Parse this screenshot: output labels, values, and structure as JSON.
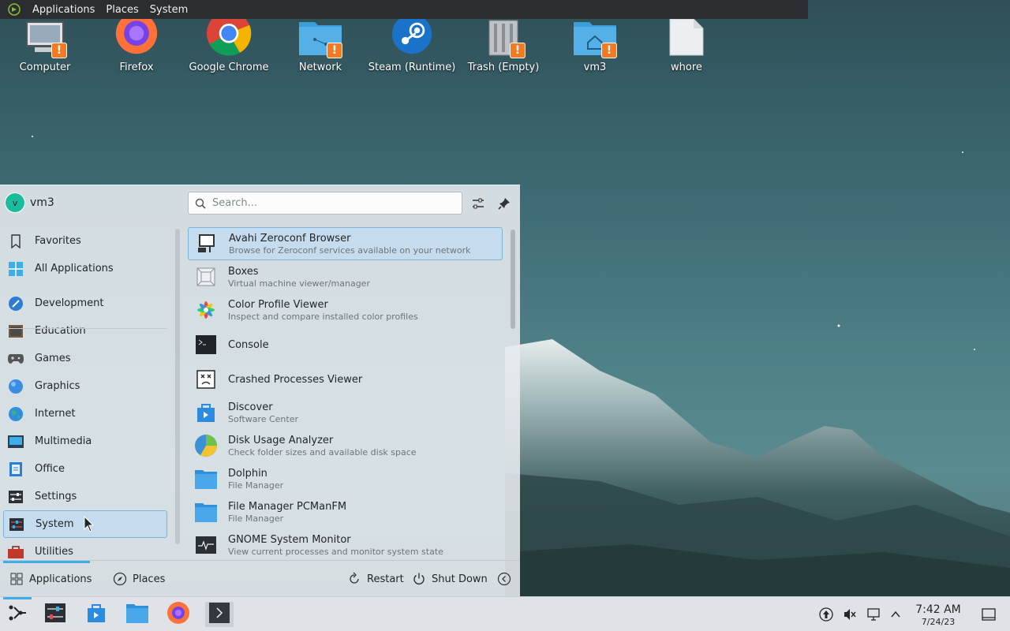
{
  "top_panel": {
    "menus": [
      "Applications",
      "Places",
      "System"
    ]
  },
  "desktop": {
    "icons": [
      {
        "label": "Computer",
        "icon": "computer-icon"
      },
      {
        "label": "Firefox",
        "icon": "firefox-icon"
      },
      {
        "label": "Google Chrome",
        "icon": "chrome-icon"
      },
      {
        "label": "Network",
        "icon": "network-folder-icon"
      },
      {
        "label": "Steam (Runtime)",
        "icon": "steam-icon"
      },
      {
        "label": "Trash (Empty)",
        "icon": "trash-icon"
      },
      {
        "label": "vm3",
        "icon": "home-folder-icon"
      },
      {
        "label": "whore",
        "icon": "file-icon"
      }
    ]
  },
  "kickoff": {
    "user": {
      "name": "vm3",
      "avatar_letter": "v"
    },
    "search": {
      "placeholder": "Search..."
    },
    "categories": [
      {
        "label": "Favorites",
        "icon": "bookmark-icon"
      },
      {
        "label": "All Applications",
        "icon": "grid-icon"
      },
      {
        "label": "Development",
        "icon": "development-icon"
      },
      {
        "label": "Education",
        "icon": "education-icon"
      },
      {
        "label": "Games",
        "icon": "gamepad-icon"
      },
      {
        "label": "Graphics",
        "icon": "graphics-icon"
      },
      {
        "label": "Internet",
        "icon": "globe-icon"
      },
      {
        "label": "Multimedia",
        "icon": "multimedia-icon"
      },
      {
        "label": "Office",
        "icon": "office-icon"
      },
      {
        "label": "Settings",
        "icon": "settings-icon"
      },
      {
        "label": "System",
        "icon": "system-icon",
        "selected": true
      },
      {
        "label": "Utilities",
        "icon": "toolbox-icon"
      }
    ],
    "apps": [
      {
        "name": "Avahi Zeroconf Browser",
        "desc": "Browse for Zeroconf services available on your network",
        "icon": "network-computer-icon",
        "selected": true
      },
      {
        "name": "Boxes",
        "desc": "Virtual machine viewer/manager",
        "icon": "boxes-icon"
      },
      {
        "name": "Color Profile Viewer",
        "desc": "Inspect and compare installed color profiles",
        "icon": "color-profile-icon"
      },
      {
        "name": "Console",
        "desc": "",
        "icon": "console-icon"
      },
      {
        "name": "Crashed Processes Viewer",
        "desc": "",
        "icon": "crash-icon"
      },
      {
        "name": "Discover",
        "desc": "Software Center",
        "icon": "discover-icon"
      },
      {
        "name": "Disk Usage Analyzer",
        "desc": "Check folder sizes and available disk space",
        "icon": "disk-usage-icon"
      },
      {
        "name": "Dolphin",
        "desc": "File Manager",
        "icon": "folder-icon"
      },
      {
        "name": "File Manager PCManFM",
        "desc": "File Manager",
        "icon": "folder-icon"
      },
      {
        "name": "GNOME System Monitor",
        "desc": "View current processes and monitor system state",
        "icon": "system-monitor-icon"
      }
    ],
    "footer": {
      "applications_label": "Applications",
      "places_label": "Places",
      "restart_label": "Restart",
      "shutdown_label": "Shut Down"
    }
  },
  "taskbar": {
    "clock_time": "7:42 AM",
    "clock_date": "7/24/23"
  },
  "colors": {
    "accent": "#3daee9",
    "selection": "#c5dcee",
    "warning": "#f47a21"
  }
}
